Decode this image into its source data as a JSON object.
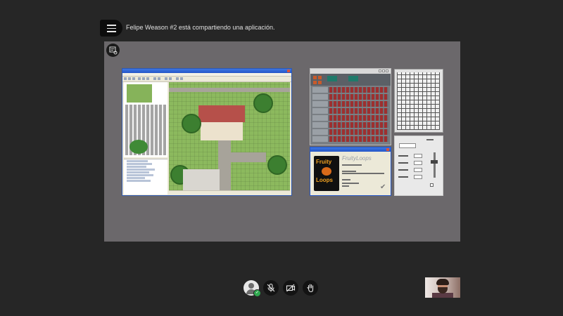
{
  "header": {
    "share_text": "Felipe Weason #2 está compartiendo una aplicación."
  },
  "shared_app": {
    "fruity_loops_about": {
      "logo_line1": "Fruity",
      "logo_line2": "Loops",
      "product_name": "FruityLoops"
    }
  },
  "controls": {
    "items": [
      {
        "name": "participant-avatar",
        "icon": "user-icon",
        "status": "connected"
      },
      {
        "name": "microphone-muted",
        "icon": "microphone-off-icon"
      },
      {
        "name": "camera-off",
        "icon": "camera-off-icon"
      },
      {
        "name": "raise-hand",
        "icon": "hand-icon"
      }
    ]
  },
  "colors": {
    "background": "#262626",
    "stage": "#6b686b",
    "status_badge": "#2fa84f",
    "fl_accent": "#f0a020"
  }
}
